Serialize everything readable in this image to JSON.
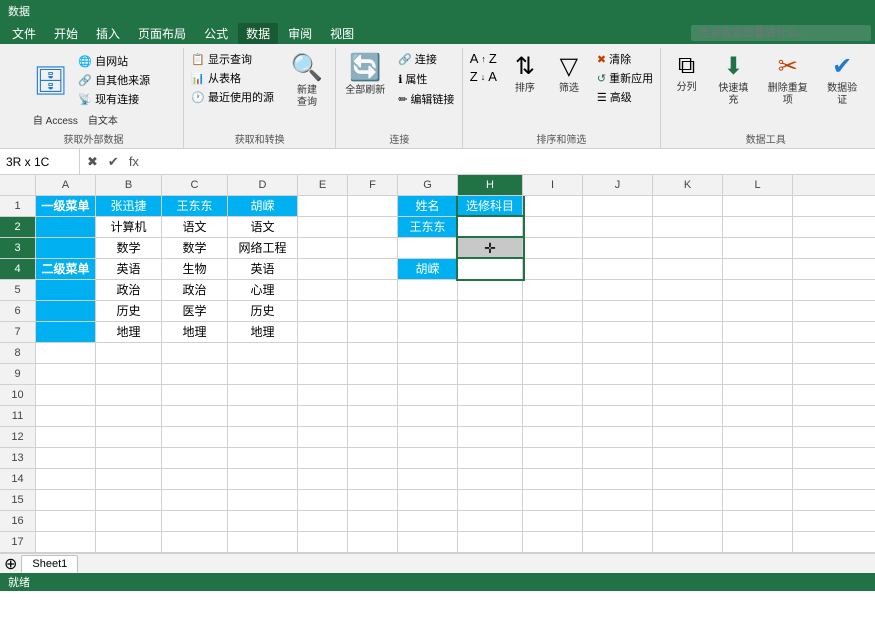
{
  "menubar": {
    "items": [
      "文件",
      "开始",
      "插入",
      "页面布局",
      "公式",
      "数据",
      "审阅",
      "视图"
    ],
    "active_index": 5,
    "search_placeholder": "告诉我您想要做什么..."
  },
  "ribbon": {
    "groups": [
      {
        "label": "获取外部数据",
        "buttons": [
          {
            "id": "access",
            "label": "自 Access",
            "icon": "🗄"
          },
          {
            "id": "web",
            "label": "自网站",
            "icon": "🌐"
          },
          {
            "id": "text",
            "label": "自文本",
            "icon": "📄"
          },
          {
            "id": "other",
            "label": "自其他来源",
            "icon": "🔗"
          }
        ]
      },
      {
        "label": "获取和转换",
        "buttons": [
          {
            "id": "show-query",
            "label": "显示查询",
            "icon": "📋"
          },
          {
            "id": "table",
            "label": "从表格",
            "icon": "📊"
          },
          {
            "id": "recent",
            "label": "最近使用的源",
            "icon": "🕐"
          },
          {
            "id": "new-query",
            "label": "新建查询",
            "icon": "🔍"
          }
        ]
      },
      {
        "label": "连接",
        "buttons": [
          {
            "id": "connections",
            "label": "连接",
            "icon": "🔗"
          },
          {
            "id": "properties",
            "label": "属性",
            "icon": "ℹ"
          },
          {
            "id": "edit-links",
            "label": "编辑链接",
            "icon": "✏"
          },
          {
            "id": "refresh-all",
            "label": "全部刷新",
            "icon": "🔄"
          }
        ]
      },
      {
        "label": "排序和筛选",
        "buttons": [
          {
            "id": "sort-a",
            "label": "↑",
            "icon": "A↑Z"
          },
          {
            "id": "sort-z",
            "label": "↓",
            "icon": "Z↓A"
          },
          {
            "id": "sort",
            "label": "排序",
            "icon": "⇅"
          },
          {
            "id": "filter",
            "label": "筛选",
            "icon": "▽"
          },
          {
            "id": "clear",
            "label": "清除",
            "icon": "✖"
          },
          {
            "id": "reapply",
            "label": "重新应用",
            "icon": "↺"
          },
          {
            "id": "advanced",
            "label": "高级",
            "icon": "☰"
          }
        ]
      },
      {
        "label": "数据工具",
        "buttons": [
          {
            "id": "split",
            "label": "分列",
            "icon": "⧉"
          },
          {
            "id": "fill",
            "label": "快速填充",
            "icon": "⬇"
          },
          {
            "id": "remove",
            "label": "删除重复项",
            "icon": "✂"
          },
          {
            "id": "validate",
            "label": "数据验证",
            "icon": "✔"
          }
        ]
      }
    ]
  },
  "formula_bar": {
    "name_box": "3R x 1C",
    "value": ""
  },
  "columns": [
    "A",
    "B",
    "C",
    "D",
    "E",
    "F",
    "G",
    "H",
    "I",
    "J",
    "K",
    "L"
  ],
  "active_col": "H",
  "active_rows": [
    2,
    3,
    4
  ],
  "spreadsheet": {
    "rows": [
      {
        "num": 1,
        "cells": {
          "A": {
            "text": "一级菜单",
            "style": "cyan",
            "rowspan": 1
          },
          "B": {
            "text": "张迅捷",
            "style": "cyan"
          },
          "C": {
            "text": "王东东",
            "style": "cyan"
          },
          "D": {
            "text": "胡嵘",
            "style": "cyan"
          },
          "E": {
            "text": "",
            "style": ""
          },
          "F": {
            "text": "",
            "style": ""
          },
          "G": {
            "text": "姓名",
            "style": "cyan"
          },
          "H": {
            "text": "选修科目",
            "style": "cyan"
          },
          "I": {
            "text": "",
            "style": ""
          },
          "J": {
            "text": "",
            "style": ""
          },
          "K": {
            "text": "",
            "style": ""
          },
          "L": {
            "text": "",
            "style": ""
          }
        }
      },
      {
        "num": 2,
        "cells": {
          "A": {
            "text": "",
            "style": "cyan"
          },
          "B": {
            "text": "计算机",
            "style": ""
          },
          "C": {
            "text": "语文",
            "style": ""
          },
          "D": {
            "text": "语文",
            "style": ""
          },
          "E": {
            "text": "",
            "style": ""
          },
          "F": {
            "text": "",
            "style": ""
          },
          "G": {
            "text": "王东东",
            "style": "cyan"
          },
          "H": {
            "text": "",
            "style": "selected"
          },
          "I": {
            "text": "",
            "style": ""
          },
          "J": {
            "text": "",
            "style": ""
          },
          "K": {
            "text": "",
            "style": ""
          },
          "L": {
            "text": "",
            "style": ""
          }
        }
      },
      {
        "num": 3,
        "cells": {
          "A": {
            "text": "",
            "style": "cyan"
          },
          "B": {
            "text": "数学",
            "style": ""
          },
          "C": {
            "text": "数学",
            "style": ""
          },
          "D": {
            "text": "网络工程",
            "style": ""
          },
          "E": {
            "text": "",
            "style": ""
          },
          "F": {
            "text": "",
            "style": ""
          },
          "G": {
            "text": "",
            "style": ""
          },
          "H": {
            "text": "",
            "style": "cursor"
          },
          "I": {
            "text": "",
            "style": ""
          },
          "J": {
            "text": "",
            "style": ""
          },
          "K": {
            "text": "",
            "style": ""
          },
          "L": {
            "text": "",
            "style": ""
          }
        }
      },
      {
        "num": 4,
        "cells": {
          "A": {
            "text": "二级菜单",
            "style": "cyan"
          },
          "B": {
            "text": "英语",
            "style": ""
          },
          "C": {
            "text": "生物",
            "style": ""
          },
          "D": {
            "text": "英语",
            "style": ""
          },
          "E": {
            "text": "",
            "style": ""
          },
          "F": {
            "text": "",
            "style": ""
          },
          "G": {
            "text": "胡嵘",
            "style": "cyan"
          },
          "H": {
            "text": "",
            "style": "selected-bottom"
          },
          "I": {
            "text": "",
            "style": ""
          },
          "J": {
            "text": "",
            "style": ""
          },
          "K": {
            "text": "",
            "style": ""
          },
          "L": {
            "text": "",
            "style": ""
          }
        }
      },
      {
        "num": 5,
        "cells": {
          "A": {
            "text": "",
            "style": "cyan"
          },
          "B": {
            "text": "政治",
            "style": ""
          },
          "C": {
            "text": "政治",
            "style": ""
          },
          "D": {
            "text": "心理",
            "style": ""
          },
          "E": {
            "text": "",
            "style": ""
          },
          "F": {
            "text": "",
            "style": ""
          },
          "G": {
            "text": "",
            "style": ""
          },
          "H": {
            "text": "",
            "style": ""
          },
          "I": {
            "text": "",
            "style": ""
          },
          "J": {
            "text": "",
            "style": ""
          },
          "K": {
            "text": "",
            "style": ""
          },
          "L": {
            "text": "",
            "style": ""
          }
        }
      },
      {
        "num": 6,
        "cells": {
          "A": {
            "text": "",
            "style": "cyan"
          },
          "B": {
            "text": "历史",
            "style": ""
          },
          "C": {
            "text": "医学",
            "style": ""
          },
          "D": {
            "text": "历史",
            "style": ""
          },
          "E": {
            "text": "",
            "style": ""
          },
          "F": {
            "text": "",
            "style": ""
          },
          "G": {
            "text": "",
            "style": ""
          },
          "H": {
            "text": "",
            "style": ""
          },
          "I": {
            "text": "",
            "style": ""
          },
          "J": {
            "text": "",
            "style": ""
          },
          "K": {
            "text": "",
            "style": ""
          },
          "L": {
            "text": "",
            "style": ""
          }
        }
      },
      {
        "num": 7,
        "cells": {
          "A": {
            "text": "",
            "style": "cyan"
          },
          "B": {
            "text": "地理",
            "style": ""
          },
          "C": {
            "text": "地理",
            "style": ""
          },
          "D": {
            "text": "地理",
            "style": ""
          },
          "E": {
            "text": "",
            "style": ""
          },
          "F": {
            "text": "",
            "style": ""
          },
          "G": {
            "text": "",
            "style": ""
          },
          "H": {
            "text": "",
            "style": ""
          },
          "I": {
            "text": "",
            "style": ""
          },
          "J": {
            "text": "",
            "style": ""
          },
          "K": {
            "text": "",
            "style": ""
          },
          "L": {
            "text": "",
            "style": ""
          }
        }
      },
      {
        "num": 8,
        "cells": {}
      },
      {
        "num": 9,
        "cells": {}
      },
      {
        "num": 10,
        "cells": {}
      },
      {
        "num": 11,
        "cells": {}
      },
      {
        "num": 12,
        "cells": {}
      },
      {
        "num": 13,
        "cells": {}
      },
      {
        "num": 14,
        "cells": {}
      },
      {
        "num": 15,
        "cells": {}
      },
      {
        "num": 16,
        "cells": {}
      },
      {
        "num": 17,
        "cells": {}
      }
    ]
  },
  "sheet_tabs": [
    "Sheet1"
  ],
  "status": {
    "items": [
      "就绪"
    ]
  }
}
